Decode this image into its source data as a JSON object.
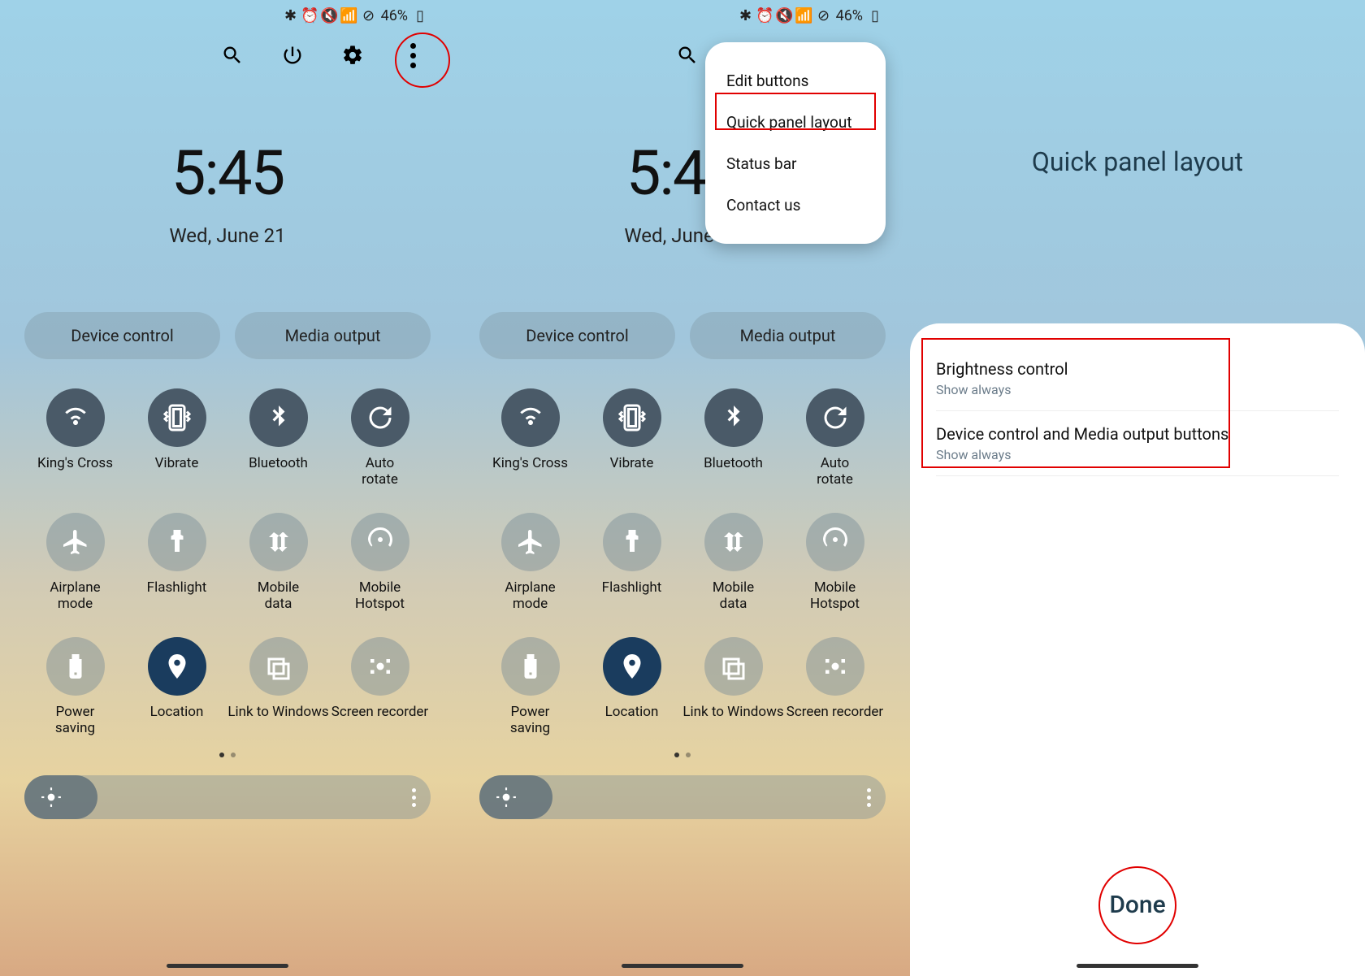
{
  "status": {
    "battery": "46%"
  },
  "clock": {
    "time": "5:45",
    "date": "Wed, June 21"
  },
  "chips": {
    "device": "Device control",
    "media": "Media output"
  },
  "tiles": [
    {
      "name": "wifi",
      "label": "King's Cross",
      "state": "on"
    },
    {
      "name": "vibrate",
      "label": "Vibrate",
      "state": "on"
    },
    {
      "name": "bluetooth",
      "label": "Bluetooth",
      "state": "on"
    },
    {
      "name": "rotate",
      "label": "Auto rotate",
      "state": "on",
      "subline": "rotate"
    },
    {
      "name": "airplane",
      "label": "Airplane mode",
      "state": "off",
      "subline": "mode"
    },
    {
      "name": "flashlight",
      "label": "Flashlight",
      "state": "off"
    },
    {
      "name": "mobiledata",
      "label": "Mobile data",
      "state": "off",
      "subline": "data"
    },
    {
      "name": "hotspot",
      "label": "Mobile Hotspot",
      "state": "off",
      "subline": "Hotspot"
    },
    {
      "name": "powersave",
      "label": "Power saving",
      "state": "off",
      "subline": "saving"
    },
    {
      "name": "location",
      "label": "Location",
      "state": "loc"
    },
    {
      "name": "link",
      "label": "Link to Windows",
      "state": "off"
    },
    {
      "name": "recorder",
      "label": "Screen recorder",
      "state": "off"
    }
  ],
  "dropdown": {
    "items": [
      "Edit buttons",
      "Quick panel layout",
      "Status bar",
      "Contact us"
    ]
  },
  "p3": {
    "title": "Quick panel layout",
    "opts": [
      {
        "t": "Brightness control",
        "s": "Show always"
      },
      {
        "t": "Device control and Media output buttons",
        "s": "Show always"
      }
    ],
    "done": "Done"
  }
}
